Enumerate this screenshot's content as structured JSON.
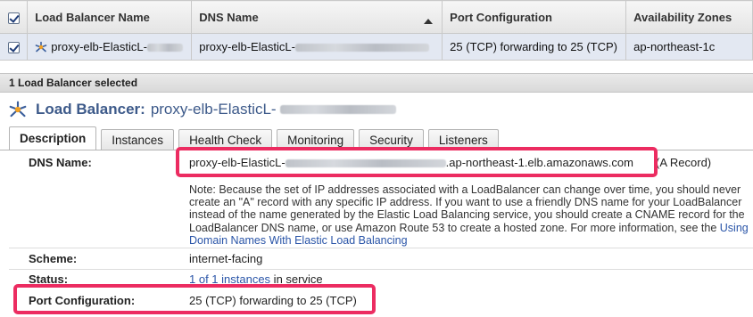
{
  "table": {
    "headers": {
      "name": "Load Balancer Name",
      "dns": "DNS Name",
      "port": "Port Configuration",
      "zones": "Availability Zones"
    },
    "rows": [
      {
        "name": "proxy-elb-ElasticL-",
        "dns": "proxy-elb-ElasticL-",
        "port": "25 (TCP) forwarding to 25 (TCP)",
        "zones": "ap-northeast-1c"
      }
    ]
  },
  "selection_bar": "1 Load Balancer selected",
  "detail": {
    "title": "Load Balancer:",
    "name": "proxy-elb-ElasticL-",
    "tabs": [
      "Description",
      "Instances",
      "Health Check",
      "Monitoring",
      "Security",
      "Listeners"
    ],
    "dns_label": "DNS Name:",
    "dns_prefix": "proxy-elb-ElasticL-",
    "dns_suffix": ".ap-northeast-1.elb.amazonaws.com",
    "dns_record": "(A Record)",
    "note_text": "Note: Because the set of IP addresses associated with a LoadBalancer can change over time, you should never create an \"A\" record with any specific IP address. If you want to use a friendly DNS name for your LoadBalancer instead of the name generated by the Elastic Load Balancing service, you should create a CNAME record for the LoadBalancer DNS name, or use Amazon Route 53 to create a hosted zone. For more information, see the ",
    "note_link": "Using Domain Names With Elastic Load Balancing",
    "scheme_label": "Scheme:",
    "scheme_value": "internet-facing",
    "status_label": "Status:",
    "status_link": "1 of 1 instances",
    "status_suffix": " in service",
    "port_label": "Port Configuration:",
    "port_value": "25 (TCP) forwarding to 25 (TCP)"
  },
  "colors": {
    "highlight": "#ec2c61",
    "link": "#2a55a8",
    "title": "#3d5a8a",
    "selected_row": "#e3e8f2"
  },
  "icons": {
    "checkbox": "checked-checkbox-icon",
    "load_balancer": "load-balancer-icon",
    "sort": "sort-ascending-icon"
  }
}
